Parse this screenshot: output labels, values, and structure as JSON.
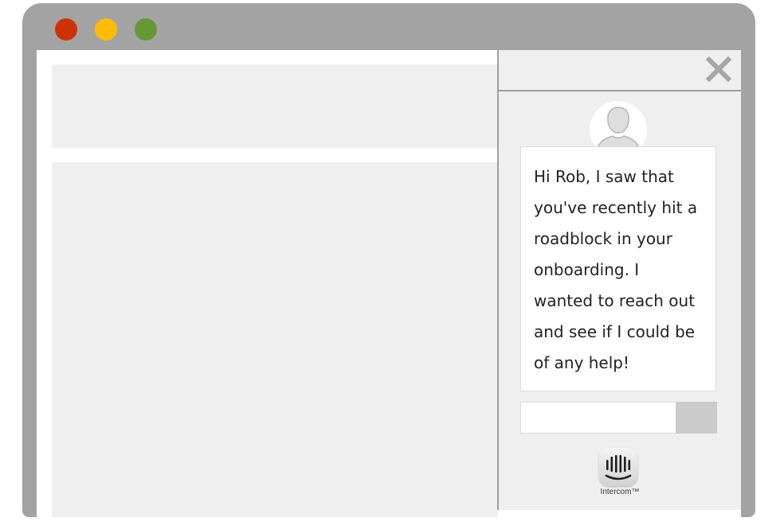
{
  "window": {
    "controls": [
      {
        "name": "close",
        "color": "#cc3300"
      },
      {
        "name": "minimize",
        "color": "#ffbb00"
      },
      {
        "name": "maximize",
        "color": "#669933"
      }
    ],
    "frame_color": "#a3a3a3"
  },
  "content": {
    "placeholder_color": "#efefef"
  },
  "chat": {
    "close_icon": "close-icon",
    "avatar_icon": "user-silhouette-icon",
    "message": "Hi Rob, I saw that you've recently hit a roadblock in your onboarding. I wanted to reach out and see if I could be of any help!",
    "input_value": "",
    "send_icon": "send-button",
    "brand_logo": "intercom-logo",
    "brand_name": "Intercom™"
  }
}
